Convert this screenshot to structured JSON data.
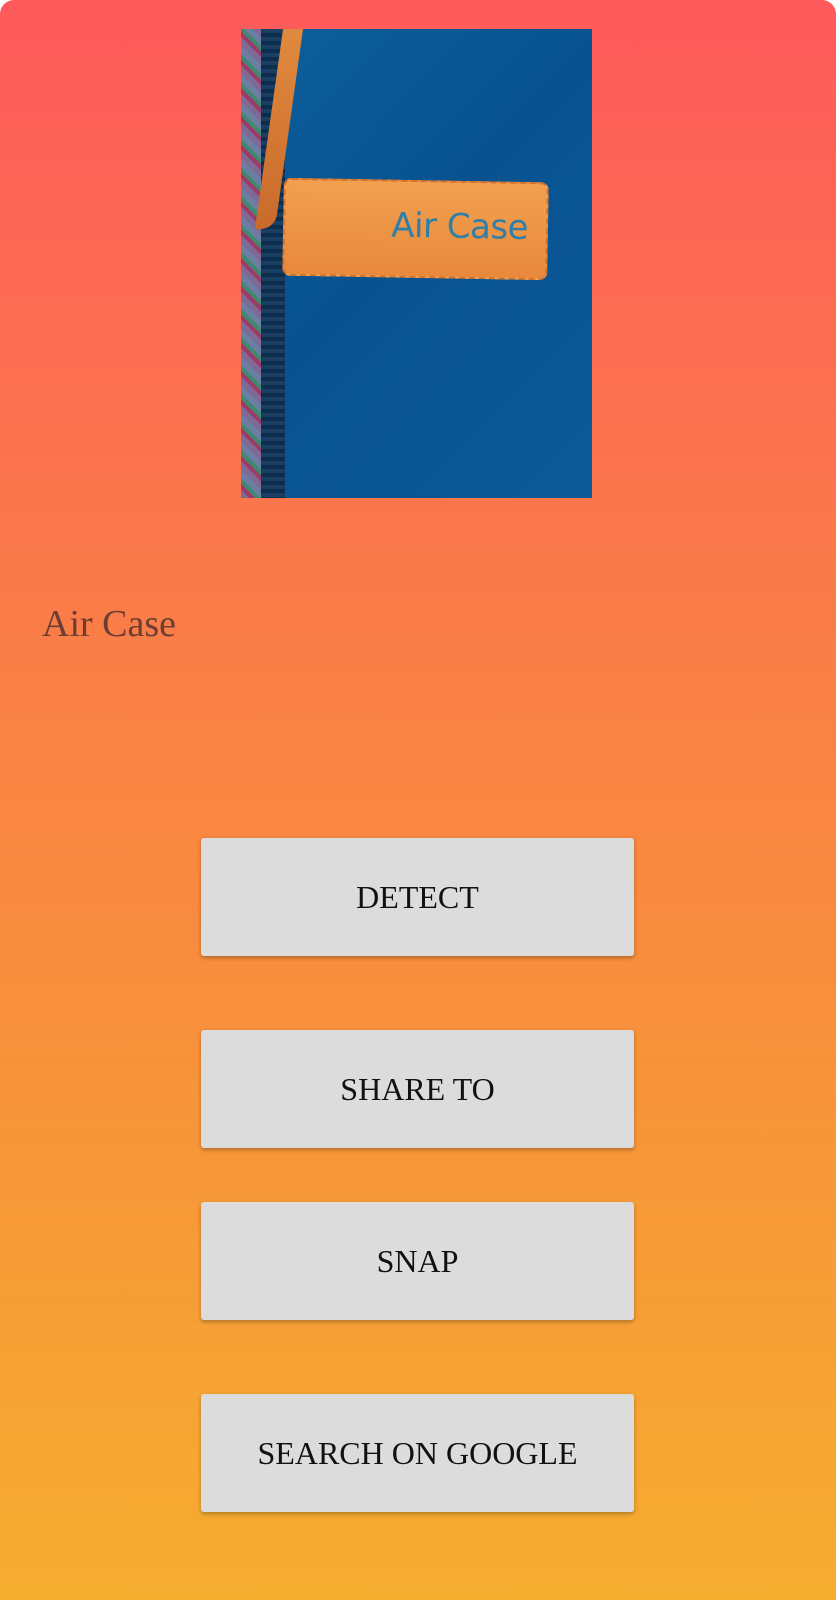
{
  "image": {
    "label_text": "Air Case"
  },
  "result": {
    "text": "Air Case"
  },
  "buttons": {
    "detect": "DETECT",
    "share": "SHARE TO",
    "snap": "SNAP",
    "search": "SEARCH ON GOOGLE"
  },
  "colors": {
    "gradient_top": "#fe5a5c",
    "gradient_bottom": "#f5ad2f",
    "button_bg": "#dcdcdc",
    "result_text": "#6a3e32"
  }
}
